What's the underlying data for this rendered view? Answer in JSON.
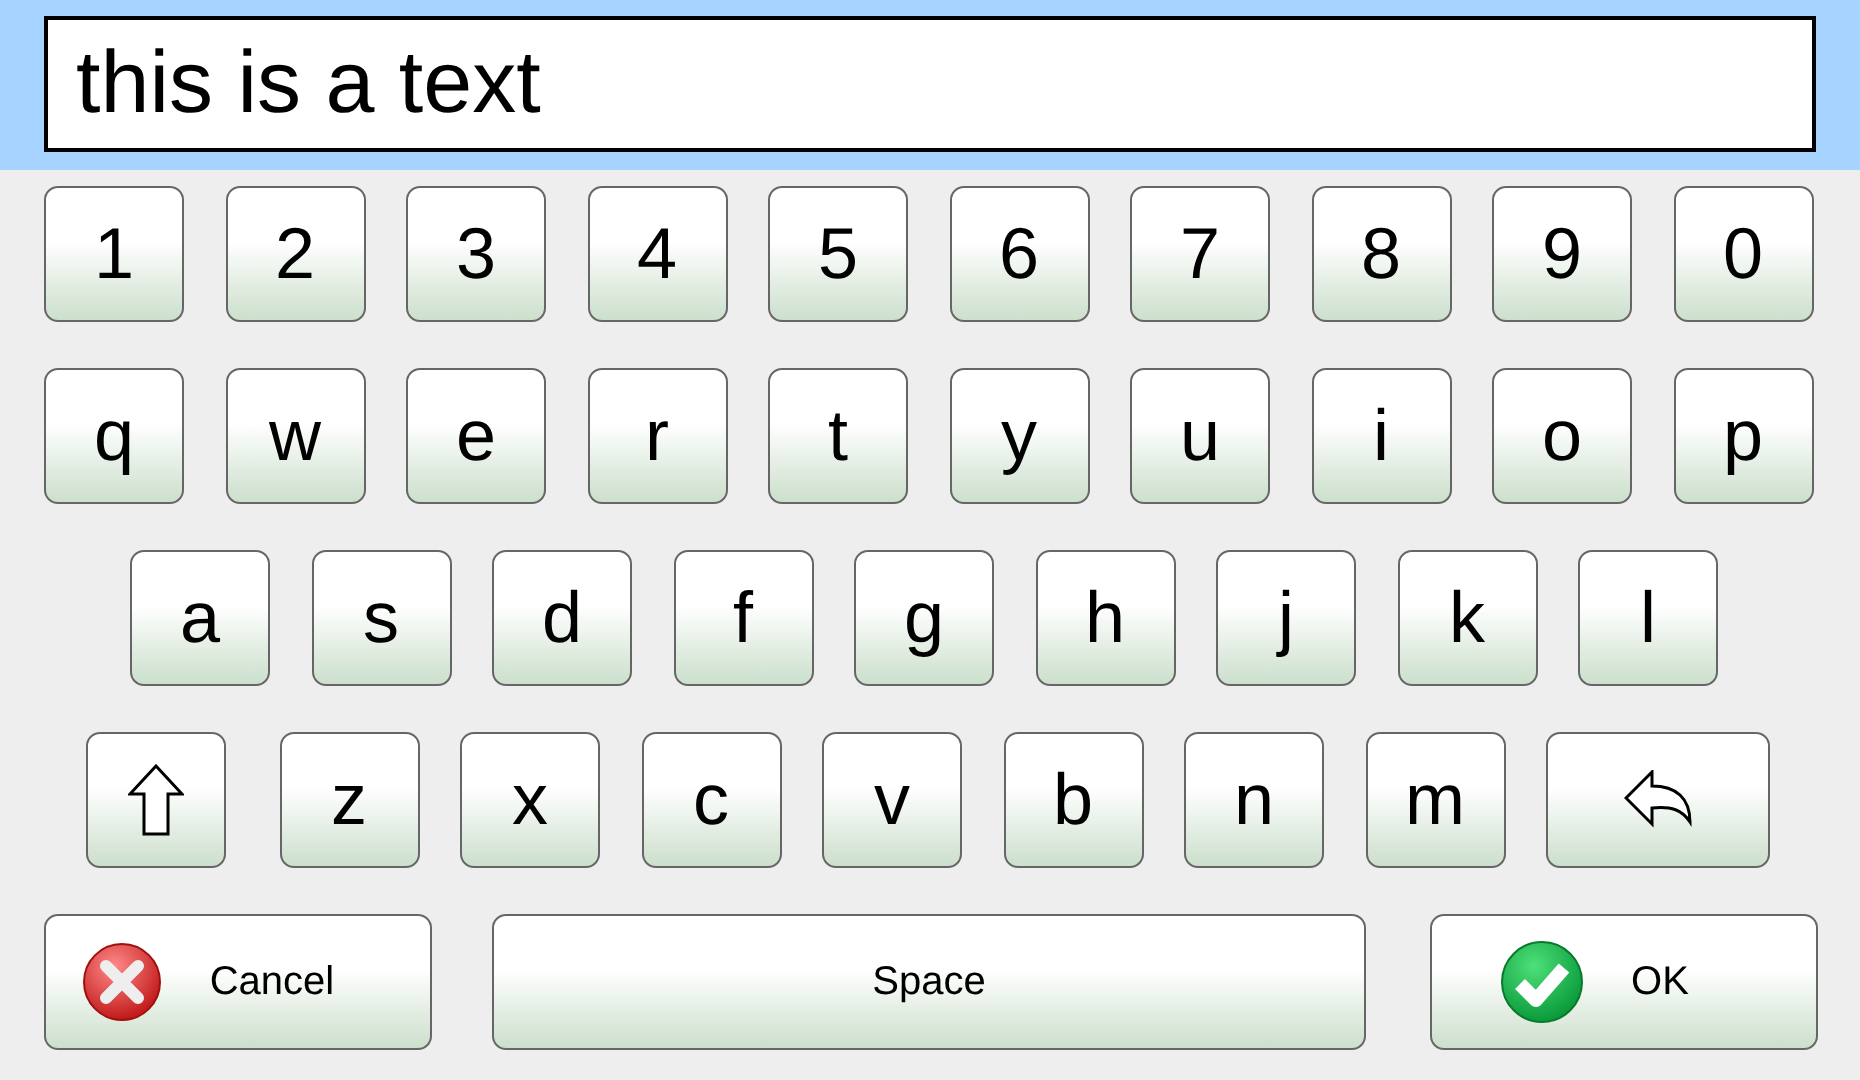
{
  "input": {
    "value": "this is a text"
  },
  "rows": [
    [
      {
        "kind": "char",
        "label": "1"
      },
      {
        "kind": "char",
        "label": "2"
      },
      {
        "kind": "char",
        "label": "3"
      },
      {
        "kind": "char",
        "label": "4"
      },
      {
        "kind": "char",
        "label": "5"
      },
      {
        "kind": "char",
        "label": "6"
      },
      {
        "kind": "char",
        "label": "7"
      },
      {
        "kind": "char",
        "label": "8"
      },
      {
        "kind": "char",
        "label": "9"
      },
      {
        "kind": "char",
        "label": "0"
      }
    ],
    [
      {
        "kind": "char",
        "label": "q"
      },
      {
        "kind": "char",
        "label": "w"
      },
      {
        "kind": "char",
        "label": "e"
      },
      {
        "kind": "char",
        "label": "r"
      },
      {
        "kind": "char",
        "label": "t"
      },
      {
        "kind": "char",
        "label": "y"
      },
      {
        "kind": "char",
        "label": "u"
      },
      {
        "kind": "char",
        "label": "i"
      },
      {
        "kind": "char",
        "label": "o"
      },
      {
        "kind": "char",
        "label": "p"
      }
    ],
    [
      {
        "kind": "char",
        "label": "a"
      },
      {
        "kind": "char",
        "label": "s"
      },
      {
        "kind": "char",
        "label": "d"
      },
      {
        "kind": "char",
        "label": "f"
      },
      {
        "kind": "char",
        "label": "g"
      },
      {
        "kind": "char",
        "label": "h"
      },
      {
        "kind": "char",
        "label": "j"
      },
      {
        "kind": "char",
        "label": "k"
      },
      {
        "kind": "char",
        "label": "l"
      }
    ],
    [
      {
        "kind": "shift"
      },
      {
        "kind": "char",
        "label": "z"
      },
      {
        "kind": "char",
        "label": "x"
      },
      {
        "kind": "char",
        "label": "c"
      },
      {
        "kind": "char",
        "label": "v"
      },
      {
        "kind": "char",
        "label": "b"
      },
      {
        "kind": "char",
        "label": "n"
      },
      {
        "kind": "char",
        "label": "m"
      },
      {
        "kind": "backspace"
      }
    ]
  ],
  "actions": [
    {
      "kind": "cancel",
      "label": "Cancel"
    },
    {
      "kind": "space",
      "label": "Space"
    },
    {
      "kind": "ok",
      "label": "OK"
    }
  ]
}
